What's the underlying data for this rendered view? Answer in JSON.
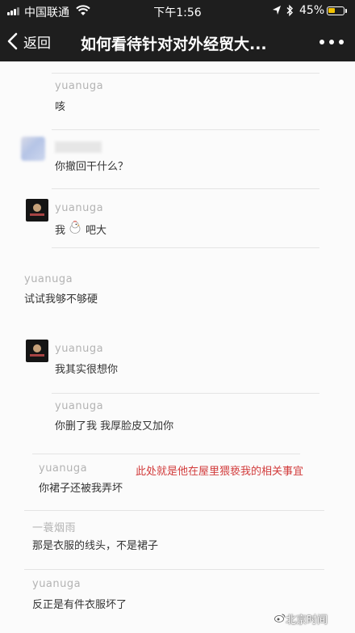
{
  "status_bar": {
    "carrier": "中国联通",
    "time": "下午1:56",
    "battery_pct": "45%",
    "battery_level": 0.45,
    "icons": [
      "signal-icon",
      "wifi-icon",
      "location-icon",
      "bluetooth-icon",
      "battery-icon"
    ]
  },
  "nav": {
    "back_label": "返回",
    "title": "如何看待针对对外经贸大...",
    "back_icon": "chevron-left-icon",
    "more_icon": "more-dots-icon"
  },
  "comments": [
    {
      "user": "yuanuga",
      "text": "咳"
    },
    {
      "user": "",
      "text": "你撤回干什么？"
    },
    {
      "user": "yuanuga",
      "text_before": "我",
      "emoji": "chicken-icon",
      "text_after": "吧大"
    },
    {
      "user": "yuanuga",
      "text": "试试我够不够硬"
    },
    {
      "user": "yuanuga",
      "text": "我其实很想你"
    },
    {
      "user": "yuanuga",
      "text": "你删了我 我厚脸皮又加你"
    },
    {
      "user": "yuanuga",
      "text": "你裙子还被我弄坏"
    },
    {
      "user": "一蓑烟雨",
      "text": "那是衣服的线头，不是裙子"
    },
    {
      "user": "yuanuga",
      "text": "反正是有件衣服坏了"
    }
  ],
  "annotation": "此处就是他在屋里猥亵我的相关事宜",
  "watermark": "北京时间",
  "colors": {
    "topbar": "#1e1e1e",
    "annotation": "#d23b3b",
    "battery": "#f2c200"
  }
}
